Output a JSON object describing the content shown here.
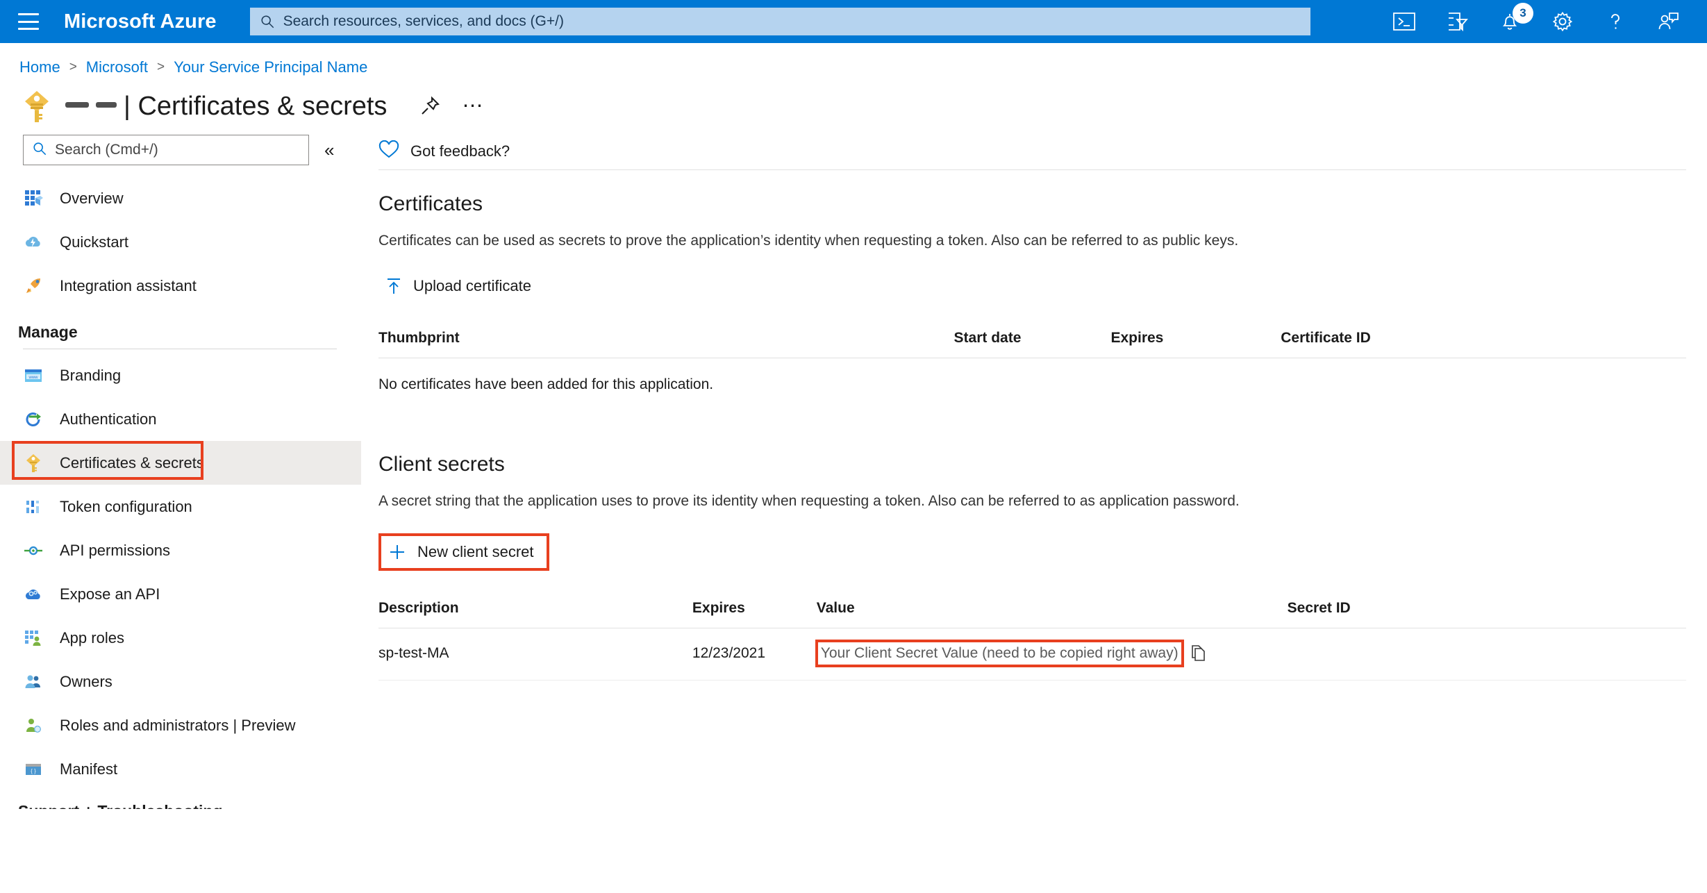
{
  "topbar": {
    "brand": "Microsoft Azure",
    "search_placeholder": "Search resources, services, and docs (G+/)",
    "notification_count": "3",
    "icons": {
      "menu": "hamburger-menu-icon",
      "search": "search-icon",
      "cloud_shell": "cloud-shell-icon",
      "directories": "directories-filter-icon",
      "notifications": "bell-icon",
      "settings": "gear-icon",
      "help": "question-mark-icon",
      "feedback": "person-feedback-icon"
    }
  },
  "breadcrumb": {
    "items": [
      "Home",
      "Microsoft",
      "Your Service Principal Name"
    ],
    "separator": ">"
  },
  "page": {
    "app_name_redacted": "",
    "separator": "|",
    "title": "Certificates & secrets",
    "pin_icon": "pin-icon",
    "more_icon": "ellipsis-icon"
  },
  "sidebar": {
    "search_placeholder": "Search (Cmd+/)",
    "collapse_label": "«",
    "top_items": [
      {
        "label": "Overview",
        "icon": "overview-grid-icon"
      },
      {
        "label": "Quickstart",
        "icon": "quickstart-cloud-icon"
      },
      {
        "label": "Integration assistant",
        "icon": "rocket-icon"
      }
    ],
    "manage_header": "Manage",
    "manage_items": [
      {
        "label": "Branding",
        "icon": "branding-browser-icon",
        "selected": false
      },
      {
        "label": "Authentication",
        "icon": "authentication-arrow-icon",
        "selected": false
      },
      {
        "label": "Certificates & secrets",
        "icon": "key-icon",
        "selected": true
      },
      {
        "label": "Token configuration",
        "icon": "token-bars-icon",
        "selected": false
      },
      {
        "label": "API permissions",
        "icon": "api-permissions-icon",
        "selected": false
      },
      {
        "label": "Expose an API",
        "icon": "expose-api-cloud-icon",
        "selected": false
      },
      {
        "label": "App roles",
        "icon": "app-roles-icon",
        "selected": false
      },
      {
        "label": "Owners",
        "icon": "owners-people-icon",
        "selected": false
      },
      {
        "label": "Roles and administrators | Preview",
        "icon": "roles-admin-icon",
        "selected": false
      },
      {
        "label": "Manifest",
        "icon": "manifest-braces-icon",
        "selected": false
      }
    ],
    "support_header": "Support + Troubleshooting"
  },
  "main": {
    "feedback_label": "Got feedback?",
    "feedback_icon": "heart-icon",
    "certificates": {
      "title": "Certificates",
      "description": "Certificates can be used as secrets to prove the application’s identity when requesting a token. Also can be referred to as public keys.",
      "upload_label": "Upload certificate",
      "upload_icon": "upload-arrow-icon",
      "columns": [
        "Thumbprint",
        "Start date",
        "Expires",
        "Certificate ID"
      ],
      "empty_message": "No certificates have been added for this application."
    },
    "client_secrets": {
      "title": "Client secrets",
      "description": "A secret string that the application uses to prove its identity when requesting a token. Also can be referred to as application password.",
      "new_label": "New client secret",
      "new_icon": "plus-icon",
      "columns": [
        "Description",
        "Expires",
        "Value",
        "Secret ID"
      ],
      "rows": [
        {
          "description": "sp-test-MA",
          "expires": "12/23/2021",
          "value": "Your Client Secret Value (need to be copied right away)",
          "secret_id": "",
          "copy_icon": "copy-icon"
        }
      ]
    }
  },
  "annotations": {
    "color": "#e8401f",
    "boxes": [
      "sidebar-certificates-and-secrets",
      "new-client-secret-button",
      "client-secret-value"
    ]
  }
}
